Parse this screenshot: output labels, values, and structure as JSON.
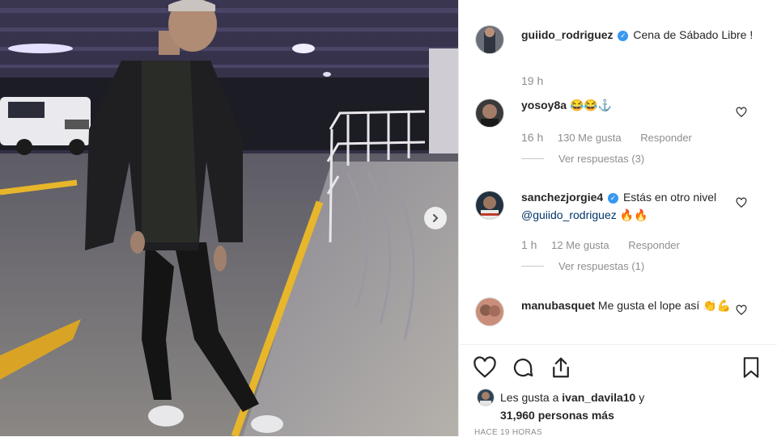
{
  "post": {
    "author": "guiido_rodriguez",
    "caption": "Cena de Sábado Libre !",
    "caption_time": "19 h"
  },
  "comments": [
    {
      "user": "yosoy8a",
      "verified": false,
      "text": "😂😂⚓",
      "time": "16 h",
      "likes": "130 Me gusta",
      "reply": "Responder",
      "replies": "Ver respuestas (3)"
    },
    {
      "user": "sanchezjorgie4",
      "verified": true,
      "text_prefix": "Estás en otro nivel ",
      "mention": "@guiido_rodriguez",
      "text_suffix": " 🔥🔥",
      "time": "1 h",
      "likes": "12 Me gusta",
      "reply": "Responder",
      "replies": "Ver respuestas (1)"
    },
    {
      "user": "manubasquet",
      "verified": false,
      "text": "Me gusta el lope así 👏💪"
    }
  ],
  "likes": {
    "prefix": "Les gusta a ",
    "user": "ivan_davila10",
    "connector": " y",
    "count": "31,960 personas más"
  },
  "posted": "HACE 19 HORAS",
  "icons": {
    "verified": "✓",
    "next": "chevron-right-icon"
  },
  "colors": {
    "verified": "#3897f0",
    "text": "#262626",
    "muted": "#8e8e8e",
    "mention": "#003569"
  }
}
